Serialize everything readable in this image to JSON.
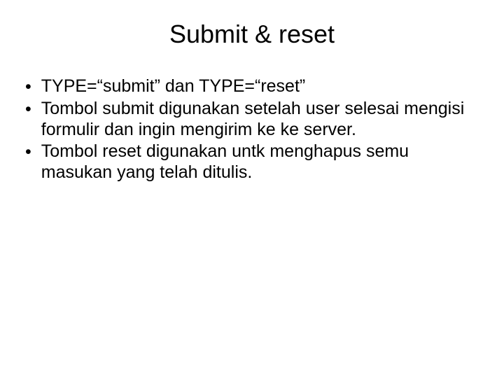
{
  "title": "Submit & reset",
  "bullets": [
    "TYPE=“submit” dan TYPE=“reset”",
    "Tombol submit digunakan setelah user selesai mengisi formulir dan ingin mengirim ke ke server.",
    "Tombol reset digunakan untk menghapus semu masukan yang telah ditulis."
  ],
  "bullet_char": "•"
}
